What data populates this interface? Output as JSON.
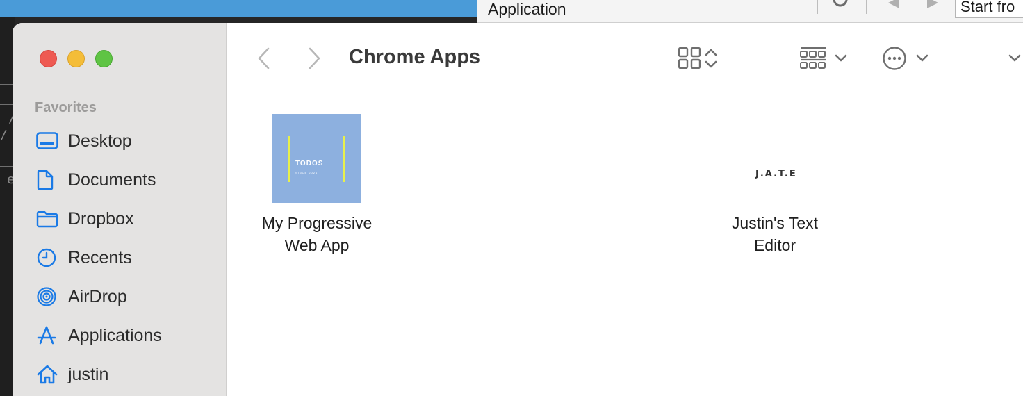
{
  "background": {
    "toolbar_title": "Application",
    "start_text": "Start fro"
  },
  "window": {
    "title": "Chrome Apps",
    "sidebar": {
      "section_header": "Favorites",
      "items": [
        {
          "label": "Desktop",
          "icon": "desktop-icon"
        },
        {
          "label": "Documents",
          "icon": "document-icon"
        },
        {
          "label": "Dropbox",
          "icon": "folder-icon"
        },
        {
          "label": "Recents",
          "icon": "clock-icon"
        },
        {
          "label": "AirDrop",
          "icon": "airdrop-icon"
        },
        {
          "label": "Applications",
          "icon": "applications-icon"
        },
        {
          "label": "justin",
          "icon": "home-icon"
        }
      ]
    },
    "toolbar": {
      "back_icon": "chevron-left-icon",
      "forward_icon": "chevron-right-icon",
      "view_icon": "icon-grid-icon",
      "group_icon": "group-grid-icon",
      "action_icon": "ellipsis-circle-icon"
    },
    "items": [
      {
        "label_line1": "My Progressive",
        "label_line2": "Web App",
        "thumb_title": "TODOS",
        "thumb_subtitle": "SINCE 2021"
      },
      {
        "label_line1": "Justin's Text",
        "label_line2": "Editor",
        "thumb_title": "J.A.T.E"
      }
    ]
  },
  "colors": {
    "accent": "#1a7ae6",
    "sidebar_bg": "#e4e3e2",
    "todo_bg": "#8db0df",
    "todo_bar": "#e8f04b"
  }
}
